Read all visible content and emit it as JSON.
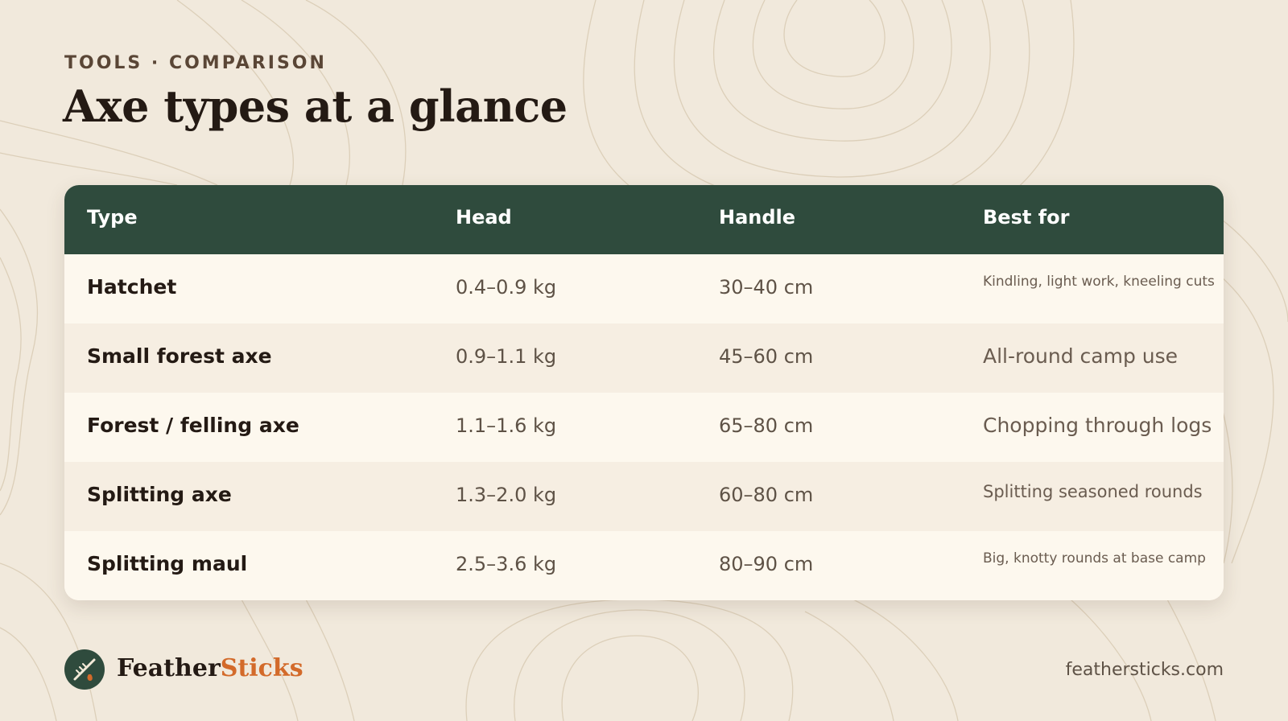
{
  "header": {
    "eyebrow": "TOOLS · COMPARISON",
    "title": "Axe types at a glance"
  },
  "table": {
    "columns": [
      "Type",
      "Head",
      "Handle",
      "Best for"
    ],
    "rows": [
      {
        "type": "Hatchet",
        "head": "0.4–0.9 kg",
        "handle": "30–40 cm",
        "best_for": "Kindling, light work, kneeling cuts"
      },
      {
        "type": "Small forest axe",
        "head": "0.9–1.1 kg",
        "handle": "45–60 cm",
        "best_for": "All-round camp use"
      },
      {
        "type": "Forest / felling axe",
        "head": "1.1–1.6 kg",
        "handle": "65–80 cm",
        "best_for": "Chopping through logs"
      },
      {
        "type": "Splitting axe",
        "head": "1.3–2.0 kg",
        "handle": "60–80 cm",
        "best_for": "Splitting seasoned rounds"
      },
      {
        "type": "Splitting maul",
        "head": "2.5–3.6 kg",
        "handle": "80–90 cm",
        "best_for": "Big, knotty rounds at base camp"
      }
    ]
  },
  "footer": {
    "logo_icon": "axe-logo-icon",
    "brand_part1": "Feather",
    "brand_part2": "Sticks",
    "website": "feathersticks.com"
  },
  "colors": {
    "background": "#f1e9dc",
    "header_row": "#2f4b3d",
    "accent": "#d36a2a",
    "text_dark": "#241a14"
  }
}
